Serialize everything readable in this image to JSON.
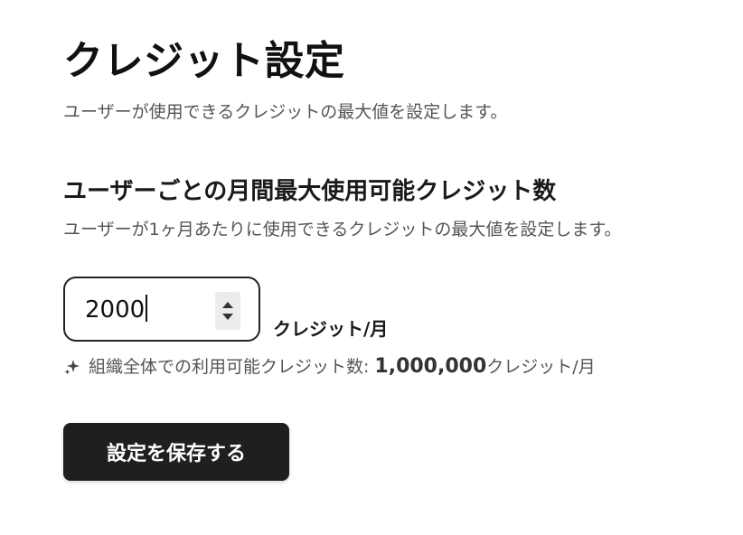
{
  "header": {
    "title": "クレジット設定",
    "description": "ユーザーが使用できるクレジットの最大値を設定します。"
  },
  "section": {
    "title": "ユーザーごとの月間最大使用可能クレジット数",
    "description": "ユーザーが1ヶ月あたりに使用できるクレジットの最大値を設定します。"
  },
  "credit_input": {
    "value": "2000",
    "unit": "クレジット/月"
  },
  "org_info": {
    "icon": "sparkle-icon",
    "label": "組織全体での利用可能クレジット数:",
    "amount": "1,000,000",
    "unit": "クレジット/月"
  },
  "actions": {
    "save_label": "設定を保存する"
  },
  "colors": {
    "button_bg": "#1f1f1f",
    "button_text": "#ffffff",
    "muted_text": "#555555"
  }
}
